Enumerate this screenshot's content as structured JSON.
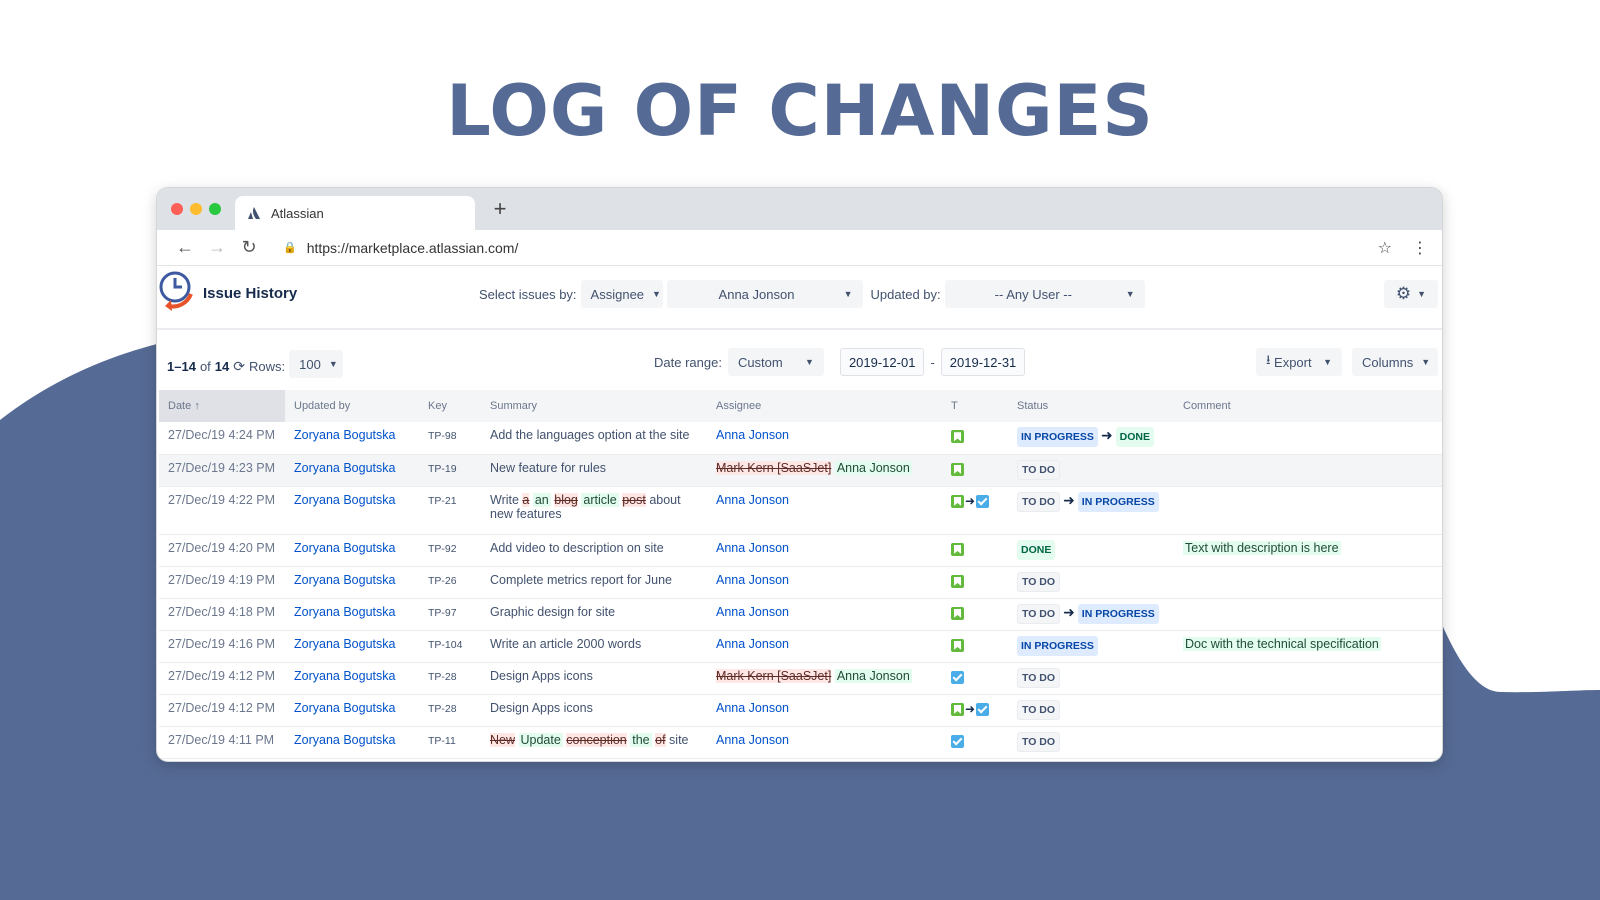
{
  "headline": "LOG OF CHANGES",
  "colors": {
    "brand": "#556a94",
    "link": "#0052cc",
    "wave": "#556a94"
  },
  "browser": {
    "tab_title": "Atlassian",
    "new_tab_symbol": "+",
    "url": "https://marketplace.atlassian.com/",
    "icons": [
      "back-icon",
      "forward-icon",
      "reload-icon",
      "lock-icon",
      "star-icon",
      "menu-icon"
    ]
  },
  "app": {
    "title": "Issue History",
    "select_issues_label": "Select issues by:",
    "select_issues_value": "Assignee",
    "assignee_value": "Anna Jonson",
    "updated_by_label": "Updated by:",
    "updated_by_value": "-- Any User --"
  },
  "toolbar": {
    "range_start": "1",
    "range_end": "14",
    "of_label": "of",
    "total": "14",
    "rows_label": "Rows:",
    "rows_value": "100",
    "date_range_label": "Date range:",
    "date_range_value": "Custom",
    "date_from": "2019-12-01",
    "date_separator": "-",
    "date_to": "2019-12-31",
    "export_label": "Export",
    "columns_label": "Columns"
  },
  "table": {
    "headers": {
      "date": "Date",
      "updated_by": "Updated by",
      "key": "Key",
      "summary": "Summary",
      "assignee": "Assignee",
      "type": "T",
      "status": "Status",
      "comment": "Comment"
    },
    "rows": [
      {
        "date": "27/Dec/19 4:24 PM",
        "updated_by": "Zoryana Bogutska",
        "key": "TP-98",
        "summary": [
          {
            "t": "Add the languages option at the site",
            "s": "plain"
          }
        ],
        "assignee": [
          {
            "t": "Anna Jonson",
            "s": "link"
          }
        ],
        "types": [
          "story"
        ],
        "status": [
          {
            "t": "IN PROGRESS",
            "c": "prog"
          },
          {
            "t": "DONE",
            "c": "done"
          }
        ],
        "comment": ""
      },
      {
        "date": "27/Dec/19 4:23 PM",
        "updated_by": "Zoryana Bogutska",
        "key": "TP-19",
        "summary": [
          {
            "t": "New feature for rules",
            "s": "plain"
          }
        ],
        "assignee": [
          {
            "t": "Mark Kern [SaaSJet]",
            "s": "del"
          },
          {
            "t": "Anna Jonson",
            "s": "ins"
          }
        ],
        "types": [
          "story"
        ],
        "status": [
          {
            "t": "TO DO",
            "c": "todo"
          }
        ],
        "comment": ""
      },
      {
        "date": "27/Dec/19 4:22 PM",
        "updated_by": "Zoryana Bogutska",
        "key": "TP-21",
        "summary": [
          {
            "t": "Write",
            "s": "plain"
          },
          {
            "t": "a",
            "s": "del"
          },
          {
            "t": "an",
            "s": "ins"
          },
          {
            "t": "blog",
            "s": "del"
          },
          {
            "t": "article",
            "s": "ins"
          },
          {
            "t": "post",
            "s": "del"
          },
          {
            "t": "about new features",
            "s": "plain"
          }
        ],
        "assignee": [
          {
            "t": "Anna Jonson",
            "s": "link"
          }
        ],
        "types": [
          "story",
          "task"
        ],
        "status": [
          {
            "t": "TO DO",
            "c": "todo"
          },
          {
            "t": "IN PROGRESS",
            "c": "prog"
          }
        ],
        "comment": ""
      },
      {
        "date": "27/Dec/19 4:20 PM",
        "updated_by": "Zoryana Bogutska",
        "key": "TP-92",
        "summary": [
          {
            "t": "Add video to description on site",
            "s": "plain"
          }
        ],
        "assignee": [
          {
            "t": "Anna Jonson",
            "s": "link"
          }
        ],
        "types": [
          "story"
        ],
        "status": [
          {
            "t": "DONE",
            "c": "done"
          }
        ],
        "comment": "Text with description is here"
      },
      {
        "date": "27/Dec/19 4:19 PM",
        "updated_by": "Zoryana Bogutska",
        "key": "TP-26",
        "summary": [
          {
            "t": "Complete metrics report for June",
            "s": "plain"
          }
        ],
        "assignee": [
          {
            "t": "Anna Jonson",
            "s": "link"
          }
        ],
        "types": [
          "story"
        ],
        "status": [
          {
            "t": "TO DO",
            "c": "todo"
          }
        ],
        "comment": ""
      },
      {
        "date": "27/Dec/19 4:18 PM",
        "updated_by": "Zoryana Bogutska",
        "key": "TP-97",
        "summary": [
          {
            "t": "Graphic design for site",
            "s": "plain"
          }
        ],
        "assignee": [
          {
            "t": "Anna Jonson",
            "s": "link"
          }
        ],
        "types": [
          "story"
        ],
        "status": [
          {
            "t": "TO DO",
            "c": "todo"
          },
          {
            "t": "IN PROGRESS",
            "c": "prog"
          }
        ],
        "comment": ""
      },
      {
        "date": "27/Dec/19 4:16 PM",
        "updated_by": "Zoryana Bogutska",
        "key": "TP-104",
        "summary": [
          {
            "t": "Write an article 2000 words",
            "s": "plain"
          }
        ],
        "assignee": [
          {
            "t": "Anna Jonson",
            "s": "link"
          }
        ],
        "types": [
          "story"
        ],
        "status": [
          {
            "t": "IN PROGRESS",
            "c": "prog"
          }
        ],
        "comment": "Doc with the technical specification"
      },
      {
        "date": "27/Dec/19 4:12 PM",
        "updated_by": "Zoryana Bogutska",
        "key": "TP-28",
        "summary": [
          {
            "t": "Design Apps icons",
            "s": "plain"
          }
        ],
        "assignee": [
          {
            "t": "Mark Kern [SaaSJet]",
            "s": "del"
          },
          {
            "t": "Anna Jonson",
            "s": "ins"
          }
        ],
        "types": [
          "task"
        ],
        "status": [
          {
            "t": "TO DO",
            "c": "todo"
          }
        ],
        "comment": ""
      },
      {
        "date": "27/Dec/19 4:12 PM",
        "updated_by": "Zoryana Bogutska",
        "key": "TP-28",
        "summary": [
          {
            "t": "Design Apps icons",
            "s": "plain"
          }
        ],
        "assignee": [
          {
            "t": "Anna Jonson",
            "s": "link"
          }
        ],
        "types": [
          "story",
          "task"
        ],
        "status": [
          {
            "t": "TO DO",
            "c": "todo"
          }
        ],
        "comment": ""
      },
      {
        "date": "27/Dec/19 4:11 PM",
        "updated_by": "Zoryana Bogutska",
        "key": "TP-11",
        "summary": [
          {
            "t": "New",
            "s": "del"
          },
          {
            "t": "Update",
            "s": "ins"
          },
          {
            "t": "conception",
            "s": "del"
          },
          {
            "t": "the",
            "s": "ins"
          },
          {
            "t": "of",
            "s": "del"
          },
          {
            "t": "site",
            "s": "plain"
          }
        ],
        "assignee": [
          {
            "t": "Anna Jonson",
            "s": "link"
          }
        ],
        "types": [
          "task"
        ],
        "status": [
          {
            "t": "TO DO",
            "c": "todo"
          }
        ],
        "comment": ""
      }
    ]
  }
}
